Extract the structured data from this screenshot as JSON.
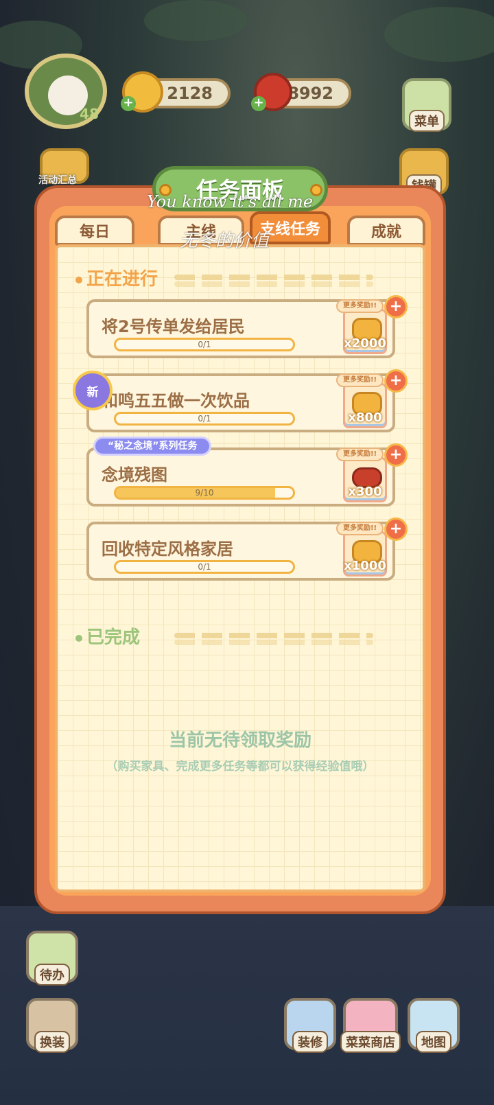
{
  "hud": {
    "level": "48",
    "coins": "2128",
    "berries": "8992",
    "menu_label": "菜单",
    "activity_label": "活动汇总",
    "right_partial_label": "钱罐"
  },
  "panel": {
    "title": "任务面板",
    "watermark_en": "You know it's all me",
    "watermark_cn": "无冬的价值",
    "tabs": [
      {
        "label": "每日"
      },
      {
        "label": "主线"
      },
      {
        "label": "支线任务"
      },
      {
        "label": "成就"
      }
    ],
    "in_progress_label": "正在进行",
    "completed_label": "已完成",
    "more_rewards_label": "更多奖励!!",
    "new_badge": "新",
    "series_tag": "“秘之念境”系列任务",
    "tasks": [
      {
        "name": "将2号传单发给居民",
        "progress": "0/1",
        "progress_value": 0.0,
        "reward": "x2000",
        "reward_icon": "gold-coins-icon"
      },
      {
        "name": "和鸣五五做一次饮品",
        "progress": "0/1",
        "progress_value": 0.0,
        "reward": "x800",
        "reward_icon": "gold-coins-icon"
      },
      {
        "name": "念境残图",
        "progress": "9/10",
        "progress_value": 0.9,
        "reward": "x300",
        "reward_icon": "red-berries-icon"
      },
      {
        "name": "回收特定风格家居",
        "progress": "0/1",
        "progress_value": 0.0,
        "reward": "x1000",
        "reward_icon": "gold-coins-icon"
      }
    ],
    "empty_title": "当前无待领取奖励",
    "empty_subtitle": "（购买家具、完成更多任务等都可以获得经验值哦）"
  },
  "bottom": {
    "todo_label": "待办",
    "dress_label": "换装",
    "decorate_label": "装修",
    "shop_label": "菜菜商店",
    "map_label": "地图"
  }
}
